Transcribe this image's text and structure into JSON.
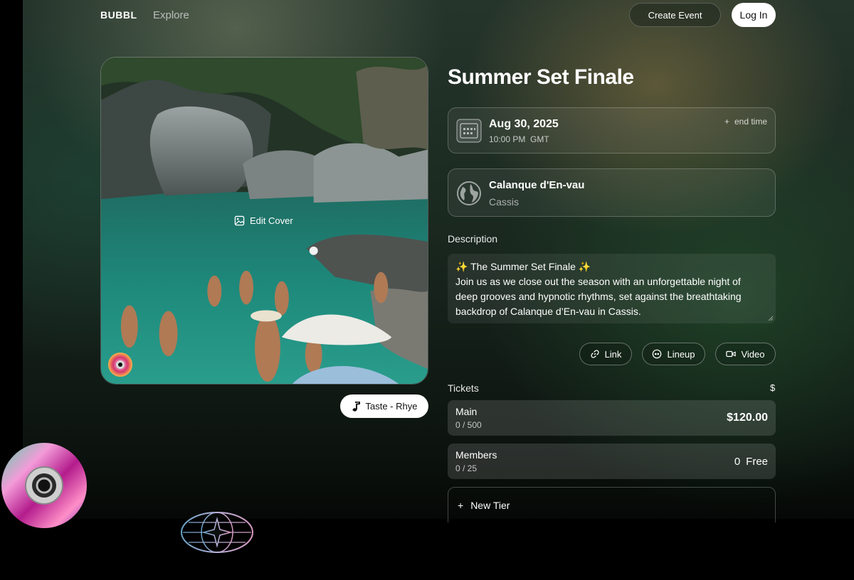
{
  "nav": {
    "logo": "BUBBL",
    "explore": "Explore",
    "create_event": "Create Event",
    "login": "Log In"
  },
  "cover": {
    "edit_label": "Edit Cover",
    "music_track": "Taste - Rhye"
  },
  "event": {
    "title": "Summer Set Finale",
    "date": "Aug 30, 2025",
    "time": "10:00 PM",
    "timezone": "GMT",
    "end_time_label": "end time",
    "location_name": "Calanque d'En-vau",
    "location_city": "Cassis"
  },
  "description": {
    "label": "Description",
    "lines": [
      "✨ The Summer Set Finale ✨",
      "Join us as we close out the season with an unforgettable night of",
      "deep grooves and hypnotic rhythms, set against the breathtaking",
      "backdrop of Calanque d’En-vau in Cassis."
    ]
  },
  "actions": {
    "link": "Link",
    "lineup": "Lineup",
    "video": "Video"
  },
  "tickets": {
    "label": "Tickets",
    "currency": "$",
    "tiers": [
      {
        "name": "Main",
        "count": "0 / 500",
        "price": "$120.00"
      },
      {
        "name": "Members",
        "count": "0 / 25",
        "price": "0",
        "price_note": "Free"
      }
    ],
    "new_tier": "New Tier"
  },
  "icons": {
    "calendar": "calendar-icon",
    "globe": "globe-icon",
    "image": "image-icon",
    "music": "music-note-icon",
    "link": "link-icon",
    "lineup": "lineup-icon",
    "video": "video-icon",
    "plus": "plus-icon"
  },
  "colors": {
    "background": "#000000",
    "surface": "#1b2a21",
    "primary_button": "#ffffff"
  }
}
